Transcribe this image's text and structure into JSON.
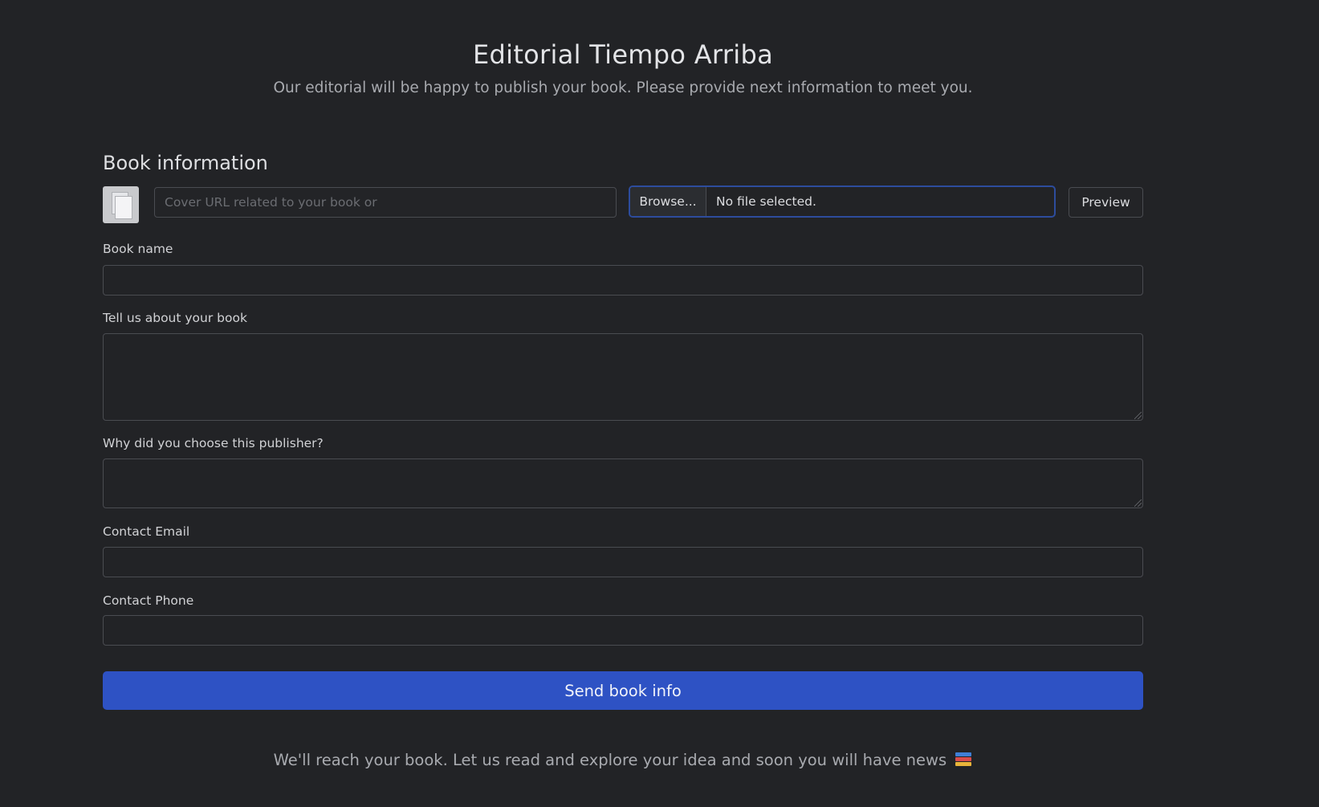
{
  "header": {
    "title": "Editorial Tiempo Arriba",
    "subtitle": "Our editorial will be happy to publish your book. Please provide next information to meet you."
  },
  "section": {
    "title": "Book information"
  },
  "cover": {
    "url_placeholder": "Cover URL related to your book or",
    "url_value": "",
    "browse_label": "Browse...",
    "file_status": "No file selected.",
    "preview_label": "Preview",
    "thumbnail_icon": "document-icon"
  },
  "fields": {
    "book_name": {
      "label": "Book name",
      "value": ""
    },
    "about": {
      "label": "Tell us about your book",
      "value": ""
    },
    "why_publisher": {
      "label": "Why did you choose this publisher?",
      "value": ""
    },
    "email": {
      "label": "Contact Email",
      "value": ""
    },
    "phone": {
      "label": "Contact Phone",
      "value": ""
    }
  },
  "submit": {
    "label": "Send book info"
  },
  "footer": {
    "text": "We'll reach your book. Let us read and explore your idea and soon you will have news",
    "icon": "books-icon"
  },
  "colors": {
    "background": "#222326",
    "primary_button": "#2e52c4",
    "focus_border": "#2d4c9d",
    "input_border": "#4a4c51"
  }
}
